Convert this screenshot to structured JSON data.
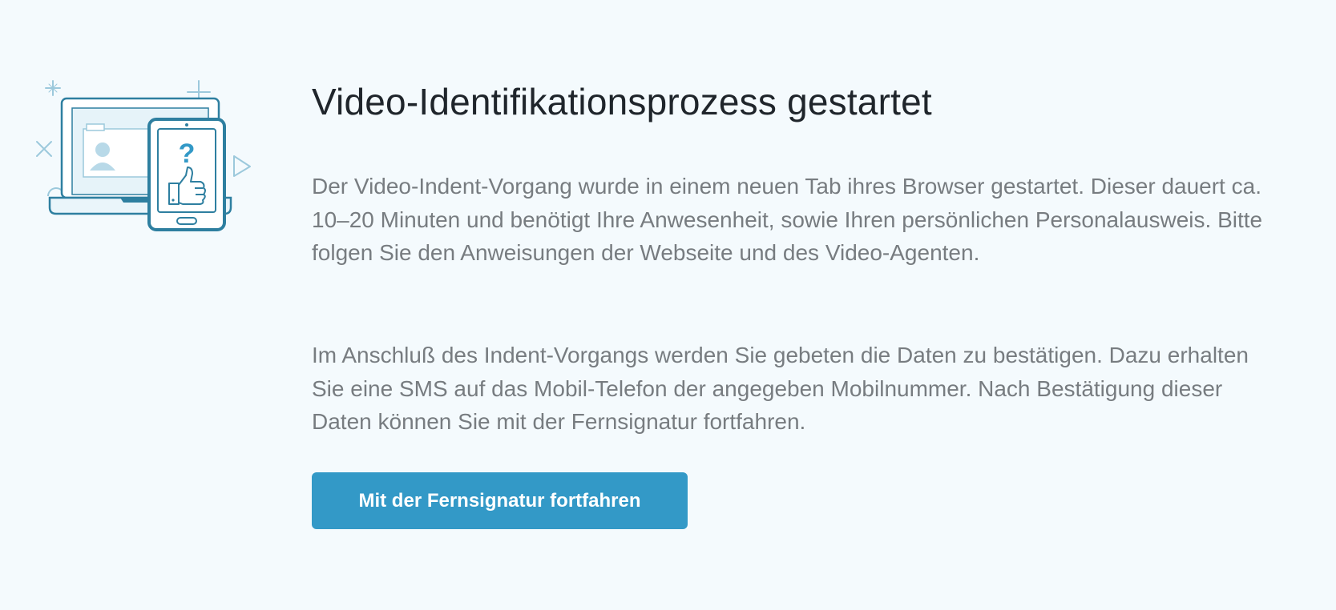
{
  "page": {
    "title": "Video-Identifikationsprozess gestartet",
    "paragraphs": [
      "Der Video-Indent-Vorgang wurde in einem neuen Tab ihres Browser gestartet. Dieser dauert ca. 10–20 Minuten und benötigt Ihre Anwesenheit, sowie Ihren persönlichen Personalausweis. Bitte folgen Sie den Anweisungen der Webseite und des Video-Agenten.",
      "Im Anschluß des Indent-Vorgangs werden Sie gebeten die Daten zu bestätigen. Dazu erhalten Sie eine SMS auf das Mobil-Telefon der angegeben Mobilnummer. Nach Bestätigung dieser Daten können Sie mit der Fernsignatur fortfahren."
    ],
    "button_label": "Mit der Fernsignatur fortfahren"
  },
  "illustration": {
    "icon": "laptop-phone-question-thumbs-up-icon",
    "question_mark": "?"
  },
  "colors": {
    "background": "#f4fafd",
    "accent": "#3399c7",
    "line": "#2e7fa0",
    "title_text": "#1f252b",
    "body_text": "#777c80"
  }
}
